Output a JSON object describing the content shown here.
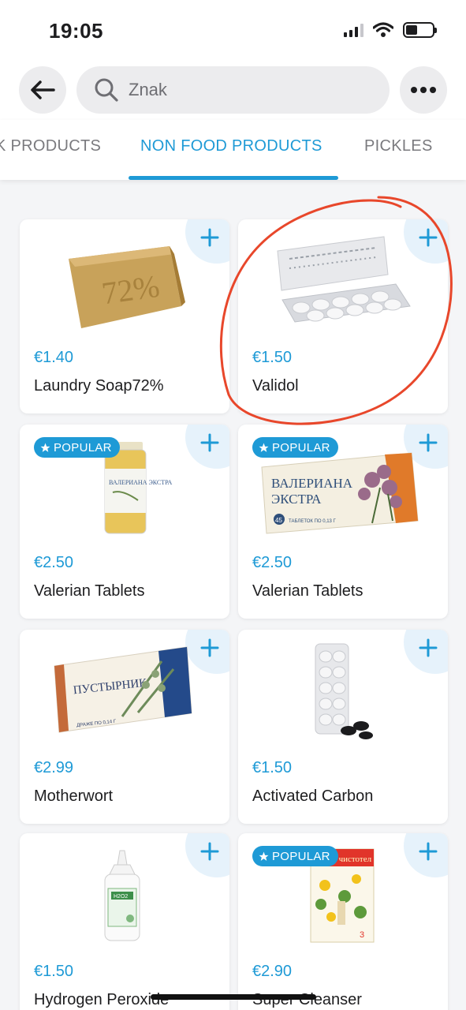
{
  "status_bar": {
    "time": "19:05"
  },
  "search": {
    "value": "Znak"
  },
  "tabs": [
    {
      "label": "K PRODUCTS"
    },
    {
      "label": "NON FOOD PRODUCTS"
    },
    {
      "label": "PICKLES"
    }
  ],
  "products": [
    {
      "price": "€1.40",
      "name": "Laundry Soap72%",
      "popular": false,
      "image": "soap-bar"
    },
    {
      "price": "€1.50",
      "name": "Validol",
      "popular": false,
      "image": "tablet-blister"
    },
    {
      "price": "€2.50",
      "name": "Valerian Tablets",
      "popular": true,
      "image": "pill-bottle"
    },
    {
      "price": "€2.50",
      "name": "Valerian Tablets",
      "popular": true,
      "image": "medicine-box"
    },
    {
      "price": "€2.99",
      "name": "Motherwort",
      "popular": false,
      "image": "medicine-box"
    },
    {
      "price": "€1.50",
      "name": "Activated Carbon",
      "popular": false,
      "image": "carbon-blister"
    },
    {
      "price": "€1.50",
      "name": "Hydrogen Peroxide",
      "popular": false,
      "image": "peroxide-bottle"
    },
    {
      "price": "€2.90",
      "name": "Super Cleanser",
      "popular": true,
      "image": "cleanser-pack"
    }
  ],
  "badge_label": "POPULAR",
  "product_image_text": {
    "soap": "72%",
    "valerian_bottle": "ВАЛЕРИАНА ЭКСТРА",
    "valerian_box_line1": "ВАЛЕРИАНА",
    "valerian_box_line2": "ЭКСТРА",
    "valerian_box_small": "ТАБЛЕТОК ПО 0,13 Г",
    "valerian_box_count": "45",
    "motherwort_box": "ПУСТЫРНИК",
    "motherwort_small": "ДРАЖЕ ПО 0,14 Г",
    "peroxide_label": "H2O2",
    "cleanser_title": "Супер чистотел",
    "cleanser_count": "3"
  },
  "colors": {
    "accent": "#1e9ad6",
    "annotation": "#e8472b",
    "add_corner": "#e6f2fb"
  }
}
